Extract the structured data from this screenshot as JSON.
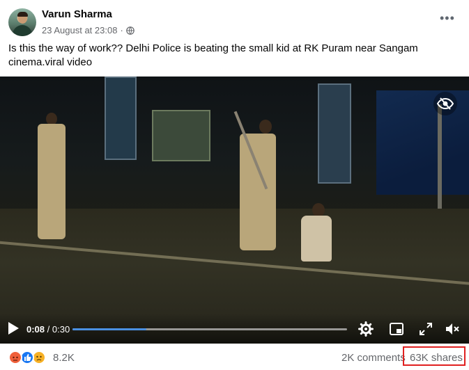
{
  "post": {
    "author": "Varun Sharma",
    "timestamp": "23 August at 23:08",
    "separator": "·",
    "audience_icon": "globe-icon",
    "more_icon": "more-options-icon",
    "more_label": "•••",
    "caption": "Is this the way of work?? Delhi Police is beating the small kid at RK Puram near Sangam cinema.viral video"
  },
  "video": {
    "current_time": "0:08",
    "total_time": "/ 0:30",
    "progress": 0.27,
    "icons": [
      "play-icon",
      "settings-gear-icon",
      "picture-in-picture-icon",
      "fullscreen-icon",
      "mute-icon",
      "hide-eye-icon"
    ]
  },
  "footer": {
    "reactions": [
      "angry",
      "like",
      "sad"
    ],
    "reaction_count": "8.2K",
    "comments": "2K comments",
    "shares": "63K shares",
    "highlight_color": "#e02020"
  }
}
